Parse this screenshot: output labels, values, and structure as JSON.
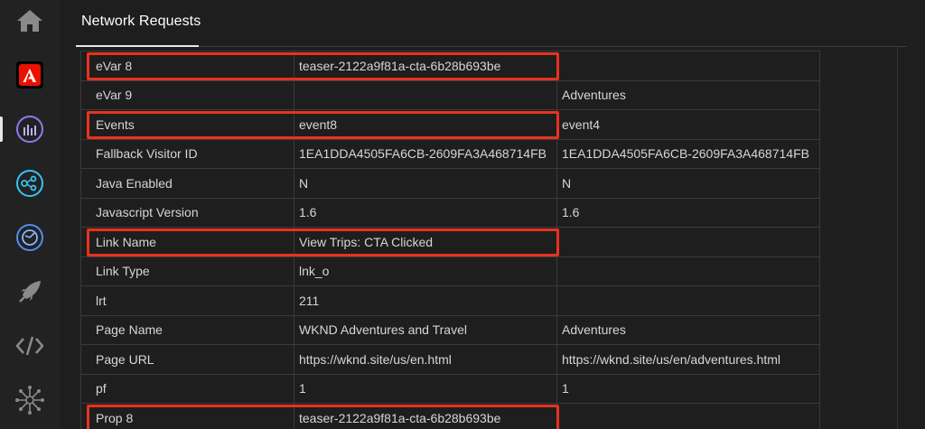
{
  "rail": {
    "items": [
      {
        "icon": "home-icon"
      },
      {
        "icon": "adobe-logo-icon"
      },
      {
        "icon": "analytics-icon",
        "active": true
      },
      {
        "icon": "experience-platform-icon"
      },
      {
        "icon": "target-icon"
      },
      {
        "icon": "launch-icon"
      },
      {
        "icon": "code-icon"
      },
      {
        "icon": "network-icon"
      }
    ]
  },
  "panel": {
    "title": "Network Requests"
  },
  "table": {
    "rows": [
      {
        "name": "eVar 8",
        "col1": "teaser-2122a9f81a-cta-6b28b693be",
        "col2": "",
        "highlight": true
      },
      {
        "name": "eVar 9",
        "col1": "",
        "col2": "Adventures"
      },
      {
        "name": "Events",
        "col1": "event8",
        "col2": "event4",
        "highlight": true
      },
      {
        "name": "Fallback Visitor ID",
        "col1": "1EA1DDA4505FA6CB-2609FA3A468714FB",
        "col2": "1EA1DDA4505FA6CB-2609FA3A468714FB"
      },
      {
        "name": "Java Enabled",
        "col1": "N",
        "col2": "N"
      },
      {
        "name": "Javascript Version",
        "col1": "1.6",
        "col2": "1.6"
      },
      {
        "name": "Link Name",
        "col1": "View Trips: CTA Clicked",
        "col2": "",
        "highlight": true
      },
      {
        "name": "Link Type",
        "col1": "lnk_o",
        "col2": ""
      },
      {
        "name": "lrt",
        "col1": "211",
        "col2": ""
      },
      {
        "name": "Page Name",
        "col1": "WKND Adventures and Travel",
        "col2": "Adventures"
      },
      {
        "name": "Page URL",
        "col1": "https://wknd.site/us/en.html",
        "col2": "https://wknd.site/us/en/adventures.html"
      },
      {
        "name": "pf",
        "col1": "1",
        "col2": "1"
      },
      {
        "name": "Prop 8",
        "col1": "teaser-2122a9f81a-cta-6b28b693be",
        "col2": "",
        "highlight": true
      }
    ]
  },
  "colors": {
    "highlight": "#e8321f",
    "adobe_red": "#eb1000",
    "accent_blue": "#6e8cff",
    "accent_cyan": "#36c5f0"
  }
}
